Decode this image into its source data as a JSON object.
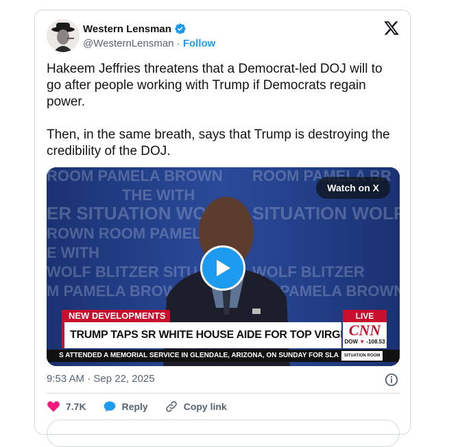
{
  "author": {
    "name": "Western Lensman",
    "handle": "@WesternLensman",
    "separator": "·",
    "follow_label": "Follow"
  },
  "tweet": {
    "text": "Hakeem Jeffries threatens that a Democrat-led DOJ will to go after people working with Trump if Democrats regain power.\n\nThen, in the same breath, says that Trump is destroying the credibility of the DOJ."
  },
  "media": {
    "watch_label": "Watch on X",
    "play_icon": "play-icon",
    "broadcast": {
      "banner_label": "NEW DEVELOPMENTS",
      "headline": "TRUMP TAPS SR WHITE HOUSE AIDE FOR TOP VIRGINIA PROSECUTOR ROLE",
      "live_label": "LIVE",
      "network_logo": "CNN",
      "dow_label": "DOW",
      "dow_change": "-108.53",
      "ticker": "S ATTENDED A MEMORIAL SERVICE IN GLENDALE, ARIZONA, ON SUNDAY FOR SLAIN C(",
      "program_tag": "SITUATION ROOM",
      "backdrop_words": [
        "ROOM PAMELA BROWN",
        "THE WITH",
        "SITUATION WOLF BLITZER",
        "ROOM PAMELA BROWN"
      ]
    }
  },
  "meta": {
    "timestamp": "9:53 AM · Sep 22, 2025"
  },
  "actions": {
    "likes": "7.7K",
    "reply_label": "Reply",
    "copy_label": "Copy link"
  },
  "colors": {
    "accent": "#1d9bf0",
    "like": "#f91880",
    "text": "#0f1419",
    "muted": "#536471",
    "cnn_red": "#c8102e"
  }
}
